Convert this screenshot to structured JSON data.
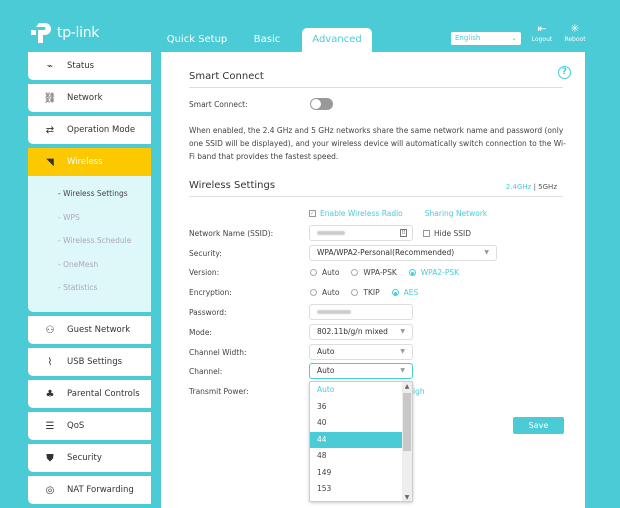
{
  "header": {
    "brand": "tp-link",
    "tabs": [
      {
        "label": "Quick Setup",
        "active": false
      },
      {
        "label": "Basic",
        "active": false
      },
      {
        "label": "Advanced",
        "active": true
      }
    ],
    "language": "English",
    "logout_label": "Logout",
    "reboot_label": "Reboot"
  },
  "sidebar": {
    "items": [
      {
        "label": "Status",
        "icon": "pulse-icon"
      },
      {
        "label": "Network",
        "icon": "network-icon"
      },
      {
        "label": "Operation Mode",
        "icon": "operation-mode-icon"
      },
      {
        "label": "Wireless",
        "icon": "wifi-icon",
        "active": true
      },
      {
        "label": "Guest Network",
        "icon": "guest-icon"
      },
      {
        "label": "USB Settings",
        "icon": "usb-icon"
      },
      {
        "label": "Parental Controls",
        "icon": "parental-icon"
      },
      {
        "label": "QoS",
        "icon": "qos-icon"
      },
      {
        "label": "Security",
        "icon": "shield-icon"
      },
      {
        "label": "NAT Forwarding",
        "icon": "nat-icon"
      }
    ],
    "wireless_sub": [
      {
        "label": "- Wireless Settings",
        "current": true
      },
      {
        "label": "- WPS"
      },
      {
        "label": "- Wireless Schedule"
      },
      {
        "label": "- OneMesh"
      },
      {
        "label": "- Statistics"
      }
    ]
  },
  "smart_connect": {
    "title": "Smart Connect",
    "label": "Smart Connect:",
    "enabled": false,
    "description": "When enabled, the 2.4 GHz and 5 GHz networks share the same network name and password (only one SSID will be displayed), and your wireless device will automatically switch connection to the Wi-Fi band that provides the fastest speed."
  },
  "wireless": {
    "title": "Wireless Settings",
    "band_24": "2.4GHz",
    "band_sep": "|",
    "band_5": "5GHz",
    "enable_radio": "Enable Wireless Radio",
    "sharing_network": "Sharing Network",
    "ssid_label": "Network Name (SSID):",
    "hide_ssid": "Hide SSID",
    "security_label": "Security:",
    "security_value": "WPA/WPA2-Personal(Recommended)",
    "version_label": "Version:",
    "version_options": [
      "Auto",
      "WPA-PSK",
      "WPA2-PSK"
    ],
    "version_selected": "WPA2-PSK",
    "encryption_label": "Encryption:",
    "encryption_options": [
      "Auto",
      "TKIP",
      "AES"
    ],
    "encryption_selected": "AES",
    "password_label": "Password:",
    "mode_label": "Mode:",
    "mode_value": "802.11b/g/n mixed",
    "width_label": "Channel Width:",
    "width_value": "Auto",
    "channel_label": "Channel:",
    "channel_value": "Auto",
    "power_label": "Transmit Power:",
    "power_partial": "igh",
    "channel_options": [
      "Auto",
      "36",
      "40",
      "44",
      "48",
      "149",
      "153"
    ],
    "channel_highlight": "44",
    "save_label": "Save"
  }
}
